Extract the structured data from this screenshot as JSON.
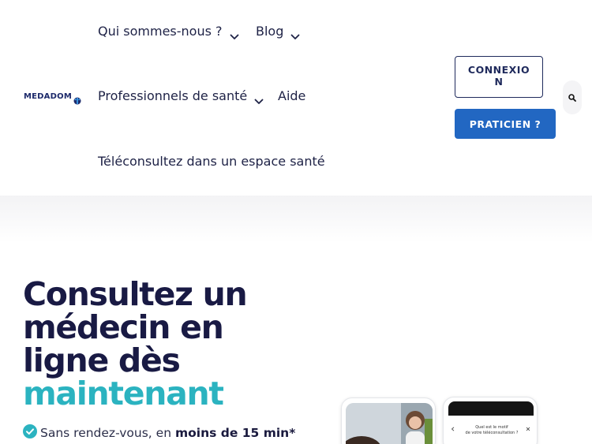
{
  "header": {
    "logo_text": "MEDADOM",
    "nav": {
      "qui": "Qui sommes-nous ?",
      "blog": "Blog",
      "pros": "Professionnels de santé",
      "aide": "Aide",
      "espace": "Téléconsultez dans un espace santé"
    },
    "buttons": {
      "connexion": "CONNEXION",
      "praticien": "PRATICIEN ?"
    },
    "icons": [
      "chevron-down-icon",
      "search-icon",
      "logo-mark-icon"
    ]
  },
  "hero": {
    "title_lines": [
      "Consultez un",
      "médecin en",
      "ligne dès"
    ],
    "title_accent": "maintenant",
    "benefit_prefix": "Sans rendez-vous, en ",
    "benefit_bold": "moins de 15 min*"
  },
  "phones": {
    "question_line1": "Quel est le motif",
    "question_line2": "de votre téléconsultation ?"
  },
  "colors": {
    "navy": "#191a44",
    "accent": "#2bb3c0",
    "primary_button": "#2267c2",
    "check": "#2bb3c0"
  }
}
